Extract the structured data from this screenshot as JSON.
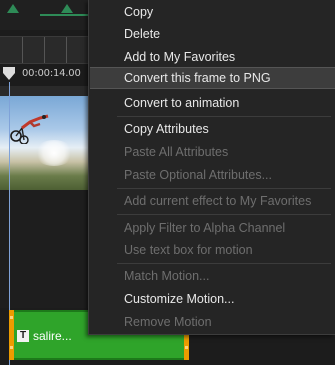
{
  "timeline": {
    "timecode": "00:00:14.00",
    "clip": {
      "icon_glyph": "T",
      "label": "salire..."
    }
  },
  "menu": {
    "items": [
      {
        "label": "Copy",
        "enabled": true
      },
      {
        "label": "Delete",
        "enabled": true
      },
      {
        "label": "Add to My Favorites",
        "enabled": true
      },
      {
        "label": "Convert this frame to PNG",
        "enabled": true,
        "highlighted": true
      },
      {
        "label": "Convert to animation",
        "enabled": true
      },
      {
        "label": "Copy Attributes",
        "enabled": true
      },
      {
        "label": "Paste All Attributes",
        "enabled": false
      },
      {
        "label": "Paste Optional Attributes...",
        "enabled": false
      },
      {
        "label": "Add current effect to My Favorites",
        "enabled": false
      },
      {
        "label": "Apply Filter to Alpha Channel",
        "enabled": false
      },
      {
        "label": "Use text box for motion",
        "enabled": false
      },
      {
        "label": "Match Motion...",
        "enabled": false
      },
      {
        "label": "Customize Motion...",
        "enabled": true
      },
      {
        "label": "Remove Motion",
        "enabled": false
      }
    ]
  },
  "colors": {
    "clip_green": "#2fa42a",
    "clip_handle": "#ec9c00",
    "menu_bg": "#252525",
    "playhead": "#7fa2d8"
  }
}
